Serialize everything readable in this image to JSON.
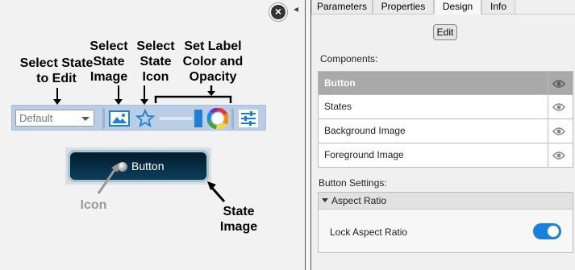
{
  "annotations": {
    "select_state_to_edit": [
      "Select State",
      "to Edit"
    ],
    "select_state_image": [
      "Select",
      "State",
      "Image"
    ],
    "select_state_icon": [
      "Select",
      "State",
      "Icon"
    ],
    "set_label_color": [
      "Set Label",
      "Color and",
      "Opacity"
    ],
    "icon": "Icon",
    "state_image": [
      "State",
      "Image"
    ]
  },
  "toolbar": {
    "state_select_value": "Default",
    "opacity_slider_value": 1.0
  },
  "preview": {
    "button_label": "Button"
  },
  "tabs": [
    {
      "label": "Parameters",
      "active": false
    },
    {
      "label": "Properties",
      "active": false
    },
    {
      "label": "Design",
      "active": true
    },
    {
      "label": "Info",
      "active": false
    }
  ],
  "design": {
    "edit_label": "Edit",
    "components_label": "Components:",
    "components": [
      {
        "label": "Button",
        "selected": true
      },
      {
        "label": "States",
        "selected": false
      },
      {
        "label": "Background Image",
        "selected": false
      },
      {
        "label": "Foreground Image",
        "selected": false
      }
    ],
    "button_settings_label": "Button Settings:",
    "aspect_ratio_header": "Aspect Ratio",
    "lock_aspect_ratio_label": "Lock Aspect Ratio",
    "lock_aspect_ratio_on": true
  },
  "colors": {
    "accent": "#1b7fe0",
    "toolbar_bg": "#b9cde4",
    "selected_row": "#a9a9a9"
  },
  "icons": {
    "close": "close-circle-icon",
    "state_image": "image-icon",
    "state_icon": "star-icon",
    "label_color": "color-wheel-icon",
    "settings": "sliders-icon",
    "visibility": "eye-icon"
  }
}
